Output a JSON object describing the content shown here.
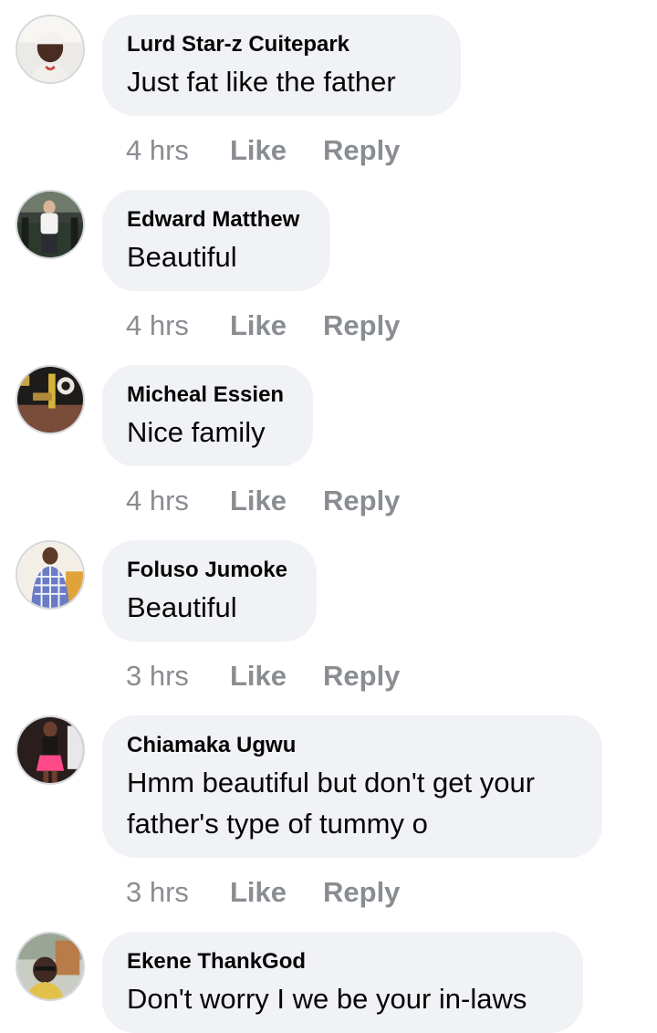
{
  "comments": [
    {
      "author": "Lurd Star-z Cuitepark",
      "text": "Just fat like the father",
      "time": "4 hrs",
      "like": "Like",
      "reply": "Reply"
    },
    {
      "author": "Edward Matthew",
      "text": "Beautiful",
      "time": "4 hrs",
      "like": "Like",
      "reply": "Reply"
    },
    {
      "author": "Micheal Essien",
      "text": "Nice family",
      "time": "4 hrs",
      "like": "Like",
      "reply": "Reply"
    },
    {
      "author": "Foluso Jumoke",
      "text": "Beautiful",
      "time": "3 hrs",
      "like": "Like",
      "reply": "Reply"
    },
    {
      "author": "Chiamaka Ugwu",
      "text": "Hmm beautiful but don't get your father's type of tummy o",
      "time": "3 hrs",
      "like": "Like",
      "reply": "Reply"
    },
    {
      "author": "Ekene ThankGod",
      "text": "Don't worry I we be your in-laws",
      "time": "",
      "like": "",
      "reply": ""
    }
  ],
  "colors": {
    "bubble": "#f0f2f5",
    "meta": "#8a8d91",
    "text": "#050505"
  }
}
